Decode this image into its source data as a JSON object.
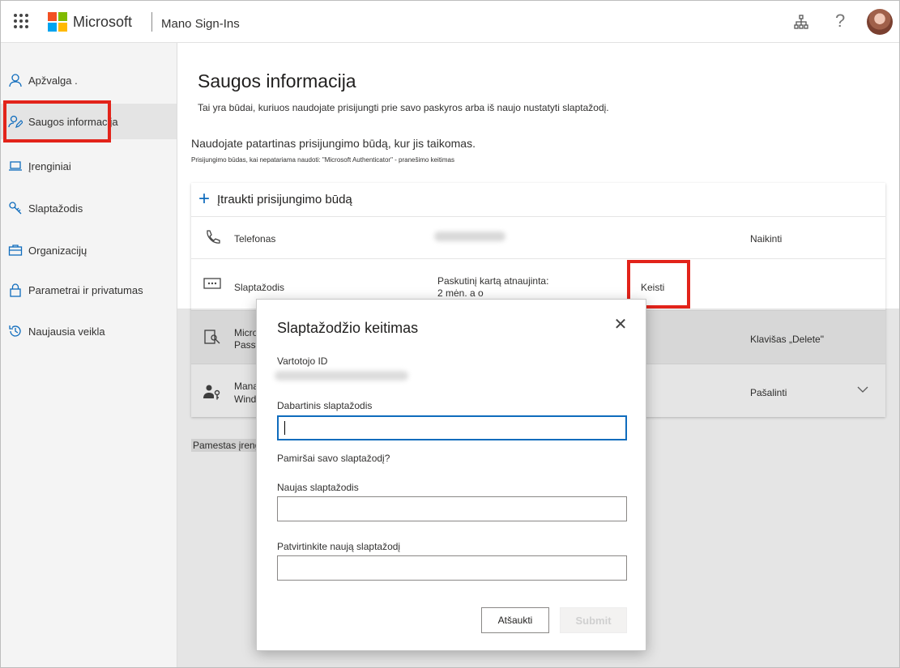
{
  "header": {
    "brand": "Microsoft",
    "app_title": "Mano Sign-Ins",
    "help_glyph": "?",
    "icons": [
      "app-launcher-icon",
      "microsoft-logo",
      "organization-icon",
      "help-icon",
      "user-avatar"
    ],
    "logo_colors": [
      "#f25022",
      "#7fba00",
      "#00a4ef",
      "#ffb900"
    ]
  },
  "sidebar": {
    "items": [
      {
        "label": "Apžvalga .",
        "icon": "person-icon"
      },
      {
        "label": "Saugos informacija",
        "icon": "security-info-icon",
        "active": true
      },
      {
        "label": "Įrenginiai",
        "icon": "laptop-icon"
      },
      {
        "label": "Slaptažodis",
        "icon": "key-icon"
      },
      {
        "label": "Organizacijų",
        "icon": "briefcase-icon"
      },
      {
        "label": "Parametrai ir privatumas",
        "icon": "lock-icon"
      },
      {
        "label": "Naujausia veikla",
        "icon": "history-icon"
      }
    ]
  },
  "main": {
    "title": "Saugos informacija",
    "description": "Tai yra būdai, kuriuos naudojate prisijungti prie savo paskyros arba iš naujo nustatyti slaptažodį.",
    "recommendation": "Naudojate patartinas prisijungimo būdą, kur jis taikomas.",
    "recommendation_sub": "Prisijungimo būdas, kai nepatariama naudoti: \"Microsoft Authenticator\" - pranešimo keitimas",
    "add_method": "Įtraukti prisijungimo būdą",
    "methods": [
      {
        "name": "Telefonas",
        "detail": "",
        "action": "Naikinti",
        "icon": "phone-icon"
      },
      {
        "name": "Slaptažodis",
        "detail_line1": "Paskutinį kartą atnaujinta:",
        "detail_line2": "2 mėn. a o",
        "action": "Keisti",
        "icon": "password-dots-icon"
      },
      {
        "name_line1": "Micro",
        "name_line2": "Passv",
        "action": "Klavišas „Delete\"",
        "icon": "passwordless-key-icon"
      },
      {
        "name_line1": "Mana",
        "name_line2": "Wind",
        "action": "Pašalinti",
        "icon": "people-key-icon"
      }
    ],
    "forgot_device": "Pamestas įrenginys?"
  },
  "dialog": {
    "title": "Slaptažodžio keitimas",
    "user_id_label": "Vartotojo ID",
    "current_password_label": "Dabartinis slaptažodis",
    "current_password_value": "",
    "forgot_password": "Pamiršai savo slaptažodį?",
    "new_password_label": "Naujas slaptažodis",
    "new_password_value": "",
    "confirm_password_label": "Patvirtinkite naują slaptažodį",
    "confirm_password_value": "",
    "cancel_label": "Atšaukti",
    "submit_label": "Submit",
    "close_glyph": "✕"
  },
  "colors": {
    "accent": "#0f6cbd",
    "highlight": "#e2231a"
  }
}
